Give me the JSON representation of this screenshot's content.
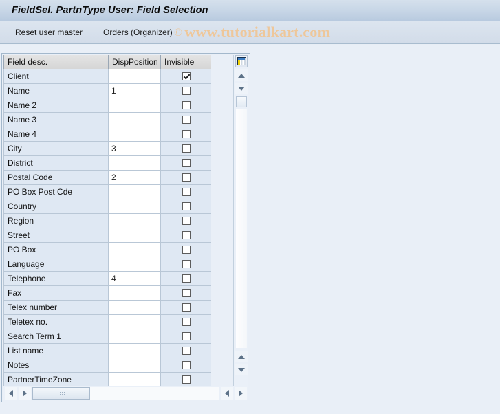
{
  "window": {
    "title": "FieldSel. PartnType User: Field Selection"
  },
  "toolbar": {
    "buttons": [
      {
        "label": "Reset user master",
        "name": "reset-user-master-button"
      },
      {
        "label": "Orders (Organizer)",
        "name": "orders-organizer-button"
      }
    ],
    "watermark": {
      "symbol": "©",
      "text": "www.tutorialkart.com",
      "color": "#eec79a"
    }
  },
  "table": {
    "columns": [
      {
        "key": "desc",
        "label": "Field desc."
      },
      {
        "key": "pos",
        "label": "DispPosition"
      },
      {
        "key": "inv",
        "label": "Invisible"
      }
    ],
    "rows": [
      {
        "desc": "Client",
        "pos": "",
        "inv": true
      },
      {
        "desc": "Name",
        "pos": "1",
        "inv": false
      },
      {
        "desc": "Name 2",
        "pos": "",
        "inv": false
      },
      {
        "desc": "Name 3",
        "pos": "",
        "inv": false
      },
      {
        "desc": "Name 4",
        "pos": "",
        "inv": false
      },
      {
        "desc": "City",
        "pos": "3",
        "inv": false
      },
      {
        "desc": "District",
        "pos": "",
        "inv": false
      },
      {
        "desc": "Postal Code",
        "pos": "2",
        "inv": false
      },
      {
        "desc": "PO Box Post Cde",
        "pos": "",
        "inv": false
      },
      {
        "desc": "Country",
        "pos": "",
        "inv": false
      },
      {
        "desc": "Region",
        "pos": "",
        "inv": false
      },
      {
        "desc": "Street",
        "pos": "",
        "inv": false
      },
      {
        "desc": "PO Box",
        "pos": "",
        "inv": false
      },
      {
        "desc": "Language",
        "pos": "",
        "inv": false
      },
      {
        "desc": "Telephone",
        "pos": "4",
        "inv": false
      },
      {
        "desc": "Fax",
        "pos": "",
        "inv": false
      },
      {
        "desc": "Telex number",
        "pos": "",
        "inv": false
      },
      {
        "desc": "Teletex no.",
        "pos": "",
        "inv": false
      },
      {
        "desc": "Search Term 1",
        "pos": "",
        "inv": false
      },
      {
        "desc": "List name",
        "pos": "",
        "inv": false
      },
      {
        "desc": "Notes",
        "pos": "",
        "inv": false
      },
      {
        "desc": "PartnerTimeZone",
        "pos": "",
        "inv": false
      }
    ]
  },
  "scrollbars": {
    "vertical": {
      "config_icon": "table-settings-icon",
      "up_icon": "scroll-up-icon",
      "down_icon": "scroll-down-icon"
    },
    "horizontal": {
      "left_icon": "scroll-left-icon",
      "right_icon": "scroll-right-icon"
    }
  }
}
